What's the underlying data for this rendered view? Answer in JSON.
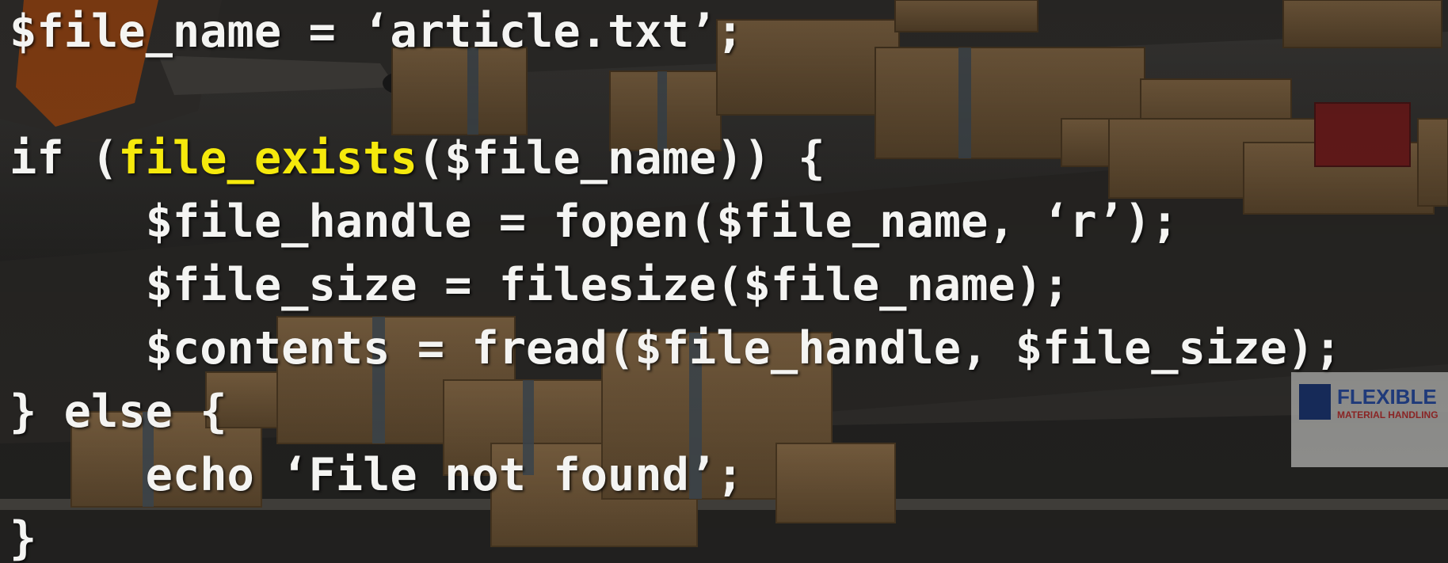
{
  "colors": {
    "code_text": "#f4f4f2",
    "highlight_function": "#f5e90c",
    "background_tint": "#2b2a28",
    "box_cardboard": "#8a6a45"
  },
  "background": {
    "logo_sign_text_1": "FLEXIBLE",
    "logo_sign_text_2": "MATERIAL HANDLING"
  },
  "code": {
    "line1": "$file_name = ‘article.txt’;",
    "line2": "",
    "line3_prefix": "if (",
    "line3_func": "file_exists",
    "line3_suffix": "($file_name)) {",
    "line4": "     $file_handle = fopen($file_name, ‘r’);",
    "line5": "     $file_size = filesize($file_name);",
    "line6": "     $contents = fread($file_handle, $file_size);",
    "line7": "} else {",
    "line8": "     echo ‘File not found’;",
    "line9": "}"
  }
}
